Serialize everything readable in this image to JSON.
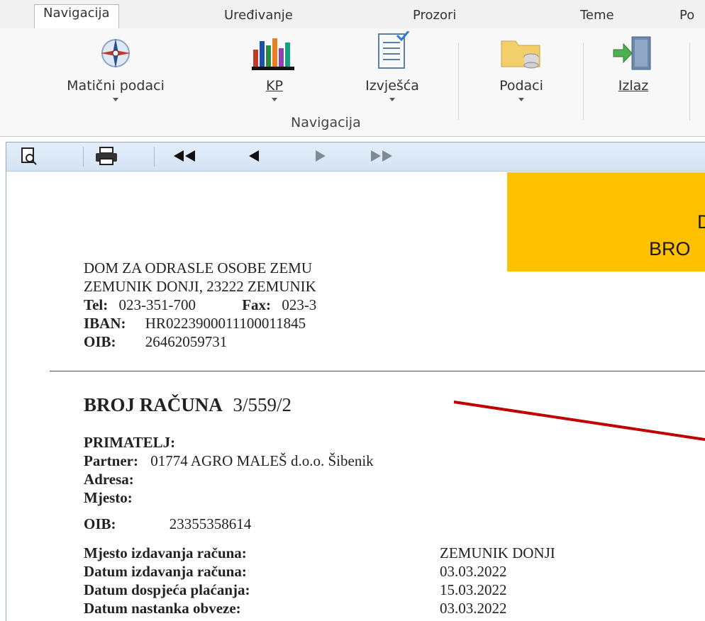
{
  "tabs": [
    "Navigacija",
    "Uređivanje",
    "Prozori",
    "Teme",
    "Po"
  ],
  "ribbon": {
    "buttons": [
      {
        "label": "Matični podaci",
        "icon": "compass-icon"
      },
      {
        "label": "KP",
        "icon": "bar-chart-icon"
      },
      {
        "label": "Izvješća",
        "icon": "report-icon"
      },
      {
        "label": "Podaci",
        "icon": "folder-database-icon"
      },
      {
        "label": "Izlaz",
        "icon": "exit-door-icon"
      }
    ],
    "group_label": "Navigacija"
  },
  "viewer_toolbar": {
    "buttons": [
      {
        "name": "preview-icon",
        "glyph": "🗋"
      },
      {
        "name": "print-icon",
        "glyph": "🖶"
      },
      {
        "name": "first-page-icon",
        "glyph": "◀◀"
      },
      {
        "name": "prev-page-icon",
        "glyph": "◀"
      },
      {
        "name": "next-page-icon",
        "glyph": "▶"
      },
      {
        "name": "last-page-icon",
        "glyph": "▶▶"
      }
    ]
  },
  "document": {
    "company_name": "DOM ZA ODRASLE OSOBE   ZEMU",
    "address": "ZEMUNIK DONJI, 23222 ZEMUNIK",
    "tel_label": "Tel:",
    "tel": "023-351-700",
    "fax_label": "Fax:",
    "fax": "023-3",
    "iban_label": "IBAN:",
    "iban": "HR0223900011100011845",
    "oib_label": "OIB:",
    "oib": "26462059731",
    "invoice_label": "BROJ RAČUNA",
    "invoice_number": "3/559/2",
    "recipient_label": "PRIMATELJ:",
    "partner_label": "Partner:",
    "partner": "01774  AGRO MALEŠ d.o.o. Šibenik",
    "adresa_label": "Adresa:",
    "mjesto_label": "Mjesto:",
    "recipient_oib_label": "OIB:",
    "recipient_oib": "23355358614",
    "details": [
      {
        "label": "Mjesto izdavanja računa:",
        "value": "ZEMUNIK DONJI"
      },
      {
        "label": "Datum izdavanja računa:",
        "value": "03.03.2022"
      },
      {
        "label": "Datum dospjeća plaćanja:",
        "value": "15.03.2022"
      },
      {
        "label": "Datum nastanka obveze:",
        "value": "03.03.2022"
      }
    ]
  },
  "callout": {
    "line1": "D",
    "line2": "BRO",
    "color": "#ffc000"
  },
  "pointer_color": "#c00000"
}
